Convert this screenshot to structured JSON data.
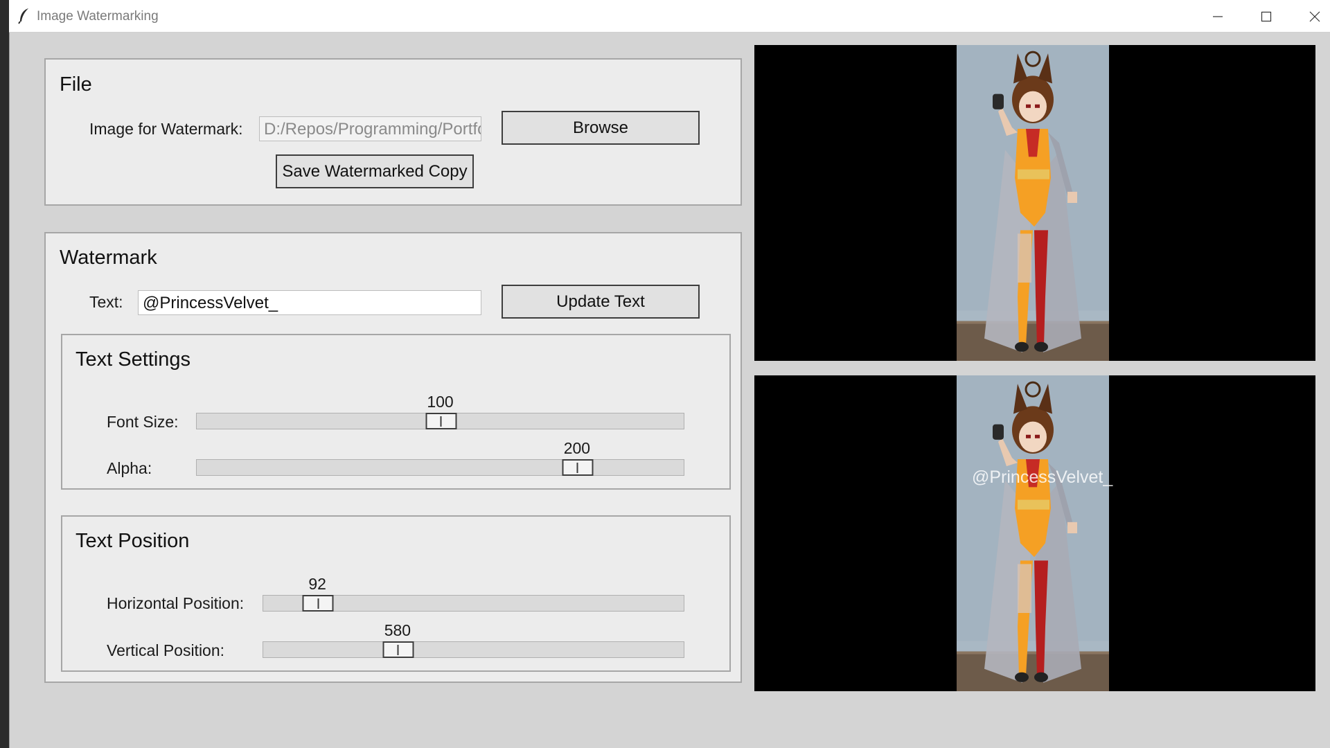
{
  "window": {
    "title": "Image Watermarking",
    "icon": "feather-icon",
    "controls": [
      "minimize-icon",
      "maximize-icon",
      "close-icon"
    ]
  },
  "file_panel": {
    "title": "File",
    "image_label": "Image for Watermark:",
    "image_path": "D:/Repos/Programming/Portfo",
    "browse_label": "Browse",
    "save_label": "Save Watermarked Copy"
  },
  "watermark_panel": {
    "title": "Watermark",
    "text_label": "Text:",
    "text_value": "@PrincessVelvet_",
    "update_label": "Update Text",
    "text_settings": {
      "title": "Text Settings",
      "font_size": {
        "label": "Font Size:",
        "value": "100",
        "fraction": 0.5
      },
      "alpha": {
        "label": "Alpha:",
        "value": "200",
        "fraction": 0.78
      }
    },
    "text_position": {
      "title": "Text Position",
      "horizontal": {
        "label": "Horizontal Position:",
        "value": "92",
        "fraction": 0.13
      },
      "vertical": {
        "label": "Vertical Position:",
        "value": "580",
        "fraction": 0.32
      }
    }
  },
  "previews": {
    "original_alt": "character-original",
    "watermarked_text": "@PrincessVelvet_"
  },
  "colors": {
    "window_bg": "#d4d4d4",
    "panel_bg": "#ececec",
    "preview_bg": "#000000",
    "photo_wall": "#a9b8c4",
    "outfit_orange": "#f5a024",
    "outfit_red": "#b51f1f"
  }
}
